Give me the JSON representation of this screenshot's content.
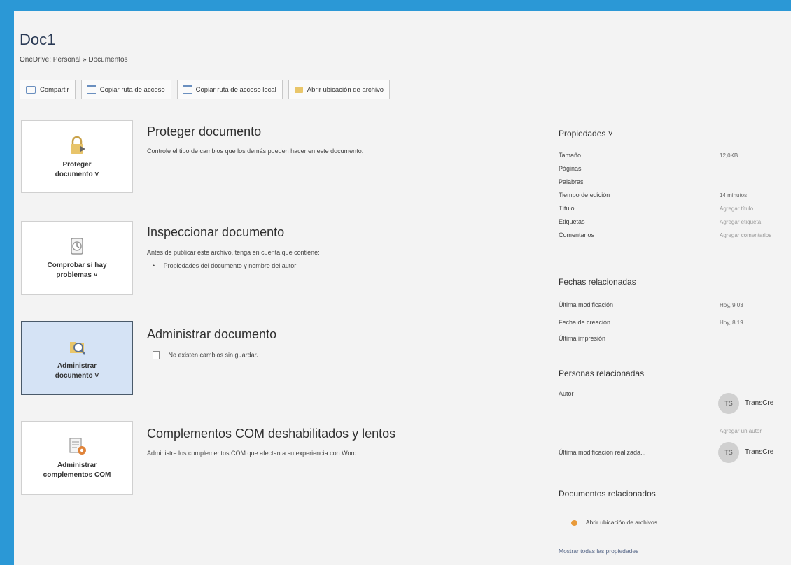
{
  "header": {
    "title": "Doc1",
    "path": "OneDrive: Personal » Documentos"
  },
  "toolbar": {
    "share": "Compartir",
    "copy_path": "Copiar ruta de acceso",
    "copy_local_path": "Copiar ruta de acceso local",
    "open_location": "Abrir ubicación de archivo"
  },
  "sections": {
    "protect": {
      "card_line1": "Proteger",
      "card_line2": "documento ˅",
      "title": "Proteger documento",
      "desc": "Controle el tipo de cambios que los demás pueden hacer en este documento."
    },
    "inspect": {
      "card_line1": "Comprobar si hay",
      "card_line2": "problemas ˅",
      "title": "Inspeccionar documento",
      "desc": "Antes de publicar este archivo, tenga en cuenta que contiene:",
      "bullet": "Propiedades del documento y nombre del autor"
    },
    "manage": {
      "card_line1": "Administrar",
      "card_line2": "documento ˅",
      "title": "Administrar documento",
      "desc": "No existen cambios sin guardar."
    },
    "com": {
      "card_line1": "Administrar",
      "card_line2": "complementos COM",
      "title": "Complementos COM deshabilitados y lentos",
      "desc": "Administre los complementos COM que afectan a su experiencia con Word."
    }
  },
  "properties": {
    "heading": "Propiedades ˅",
    "size_label": "Tamaño",
    "size_value": "12,0KB",
    "pages_label": "Páginas",
    "words_label": "Palabras",
    "edit_time_label": "Tiempo de edición",
    "edit_time_value": "14 minutos",
    "title_label": "Título",
    "title_value": "Agregar título",
    "tags_label": "Etiquetas",
    "tags_value": "Agregar etiqueta",
    "comments_label": "Comentarios",
    "comments_value": "Agregar comentarios"
  },
  "dates": {
    "heading": "Fechas relacionadas",
    "modified_label": "Última modificación",
    "modified_value": "Hoy, 9:03",
    "created_label": "Fecha de creación",
    "created_value": "Hoy, 8:19",
    "printed_label": "Última impresión"
  },
  "people": {
    "heading": "Personas relacionadas",
    "author_label": "Autor",
    "author_initials": "TS",
    "author_name": "TransCre",
    "add_author": "Agregar un autor",
    "last_modified_label": "Última modificación realizada...",
    "last_modified_initials": "TS",
    "last_modified_name": "TransCre"
  },
  "related_docs": {
    "heading": "Documentos relacionados",
    "open_location": "Abrir ubicación de archivos",
    "show_all": "Mostrar todas las propiedades"
  }
}
